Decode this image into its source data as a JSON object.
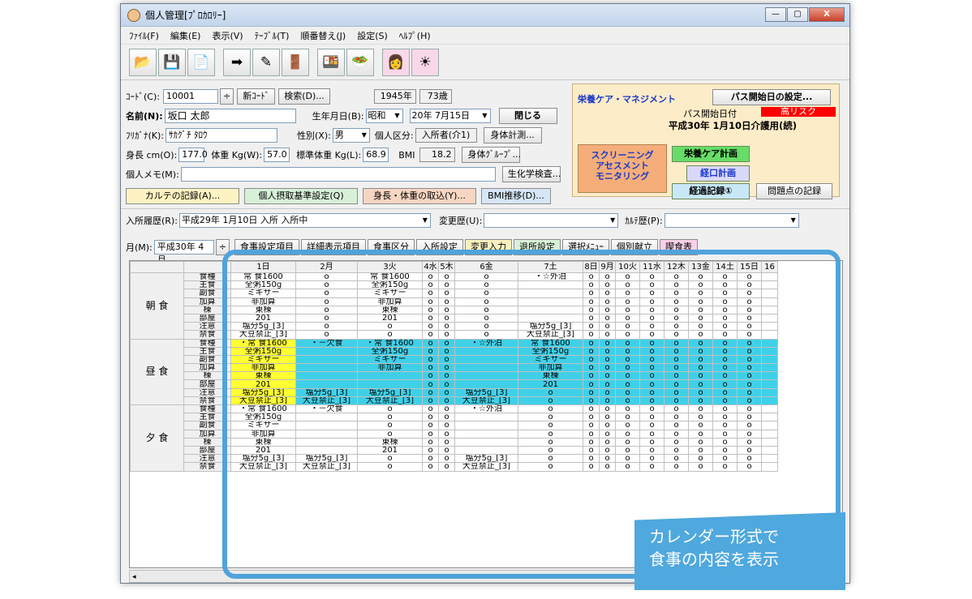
{
  "window": {
    "title": "個人管理[ﾌﾟﾛｶﾛﾘｰ]",
    "controls": [
      "—",
      "▢",
      "X"
    ]
  },
  "menu": [
    "ﾌｧｲﾙ(F)",
    "編集(E)",
    "表示(V)",
    "ﾃｰﾌﾞﾙ(T)",
    "順番替え(J)",
    "設定(S)",
    "ﾍﾙﾌﾟ(H)"
  ],
  "toolbar": [
    "folder-open",
    "save",
    "copy",
    "exit",
    "edit",
    "door",
    "person-meal",
    "salad",
    "chef",
    "sun"
  ],
  "form": {
    "code_label": "ｺｰﾄﾞ(C):",
    "code": "10001",
    "new_code": "新ｺｰﾄﾞ",
    "search": "検索(D)...",
    "birth_year": "1945年",
    "age": "73歳",
    "name_label": "名前(N):",
    "name": "坂口 太郎",
    "birth_label": "生年月日(B):",
    "era": "昭和",
    "birth_date": "20年 7月15日",
    "close": "閉じる",
    "kana_label": "ﾌﾘｶﾞﾅ(K):",
    "kana": "ｻｶｸﾞﾁ ﾀﾛｳ",
    "sex_label": "性別(X):",
    "sex": "男",
    "kubun_label": "個人区分:",
    "kubun": "入所者(介1)",
    "body_measure": "身体計測...",
    "height_label": "身長 cm(O):",
    "height": "177.0",
    "weight_label": "体重 Kg(W):",
    "weight": "57.0",
    "std_weight_label": "標準体重 Kg(L):",
    "std_weight": "68.9",
    "bmi_label": "BMI",
    "bmi": "18.2",
    "body_group": "身体ｸﾞﾙｰﾌﾟ...",
    "memo_label": "個人メモ(M):",
    "memo": "",
    "biochem": "生化学検査...",
    "karte": "カルテの記録(A)...",
    "standard": "個人摂取基準設定(Q)",
    "import": "身長・体重の取込(Y)...",
    "bmi_trend": "BMI推移(D)..."
  },
  "panel": {
    "title": "栄養ケア・マネジメント",
    "pass_btn": "パス開始日の設定...",
    "pass_start": "パス開始日付",
    "hi_risk": "高リスク",
    "date": "平成30年 1月10日介護用(続)",
    "screening": "スクリーニング\nアセスメント\nモニタリング",
    "care_plan": "栄養ケア計画",
    "oral_plan": "経口計画",
    "progress": "経過記録①",
    "problem": "問題点の記録"
  },
  "history": {
    "label": "入所履歴(R):",
    "value": "平成29年 1月10日 入所 入所中",
    "change_label": "変更歴(U):",
    "karte_label": "ｶﾙﾃ歴(P):"
  },
  "month": {
    "label": "月(M):",
    "value": "平成30年 4月",
    "buttons": [
      "食事設定項目",
      "詳細表示項目",
      "食事区分",
      "入所設定",
      "変更入力",
      "退所設定",
      "選択ﾒﾆｭｰ",
      "個別献立",
      "喫食表"
    ]
  },
  "grid": {
    "days": [
      "1日",
      "2月",
      "3火",
      "4水",
      "5木",
      "6金",
      "7土",
      "8日",
      "9月",
      "10火",
      "11水",
      "12木",
      "13金",
      "14土",
      "15日",
      "16"
    ],
    "items": [
      "食種",
      "主食",
      "副食",
      "加算",
      "棟",
      "部屋",
      "注意",
      "禁食"
    ],
    "meals": [
      {
        "name": "朝 食",
        "rows": [
          [
            "常 食1600",
            "o",
            "常 食1600",
            "o",
            "o",
            "o",
            "・☆外泊",
            "o",
            "o",
            "o",
            "o",
            "o",
            "o",
            "o",
            "o"
          ],
          [
            "全粥150g",
            "o",
            "全粥150g",
            "o",
            "o",
            "o",
            "",
            "o",
            "o",
            "o",
            "o",
            "o",
            "o",
            "o",
            "o"
          ],
          [
            "ミキサー",
            "o",
            "ミキサー",
            "o",
            "o",
            "o",
            "",
            "o",
            "o",
            "o",
            "o",
            "o",
            "o",
            "o",
            "o"
          ],
          [
            "非加算",
            "o",
            "非加算",
            "o",
            "o",
            "o",
            "",
            "o",
            "o",
            "o",
            "o",
            "o",
            "o",
            "o",
            "o"
          ],
          [
            "東棟",
            "o",
            "東棟",
            "o",
            "o",
            "o",
            "",
            "o",
            "o",
            "o",
            "o",
            "o",
            "o",
            "o",
            "o"
          ],
          [
            "201",
            "o",
            "201",
            "o",
            "o",
            "o",
            "",
            "o",
            "o",
            "o",
            "o",
            "o",
            "o",
            "o",
            "o"
          ],
          [
            "塩分5g_[3]",
            "o",
            "o",
            "o",
            "o",
            "o",
            "塩分5g_[3]",
            "o",
            "o",
            "o",
            "o",
            "o",
            "o",
            "o",
            "o"
          ],
          [
            "大豆禁止_[3]",
            "o",
            "o",
            "o",
            "o",
            "o",
            "大豆禁止_[3]",
            "o",
            "o",
            "o",
            "o",
            "o",
            "o",
            "o",
            "o"
          ]
        ]
      },
      {
        "name": "昼 食",
        "rows": [
          [
            "・常 食1600",
            "・－欠食",
            "・常 食1600",
            "o",
            "o",
            "・☆外泊",
            "常 食1600",
            "o",
            "o",
            "o",
            "o",
            "o",
            "o",
            "o",
            "o"
          ],
          [
            "全粥150g",
            "",
            "全粥150g",
            "o",
            "o",
            "",
            "全粥150g",
            "o",
            "o",
            "o",
            "o",
            "o",
            "o",
            "o",
            "o"
          ],
          [
            "ミキサー",
            "",
            "ミキサー",
            "o",
            "o",
            "",
            "ミキサー",
            "o",
            "o",
            "o",
            "o",
            "o",
            "o",
            "o",
            "o"
          ],
          [
            "非加算",
            "",
            "非加算",
            "o",
            "o",
            "",
            "非加算",
            "o",
            "o",
            "o",
            "o",
            "o",
            "o",
            "o",
            "o"
          ],
          [
            "東棟",
            "",
            "",
            "o",
            "o",
            "",
            "東棟",
            "o",
            "o",
            "o",
            "o",
            "o",
            "o",
            "o",
            "o"
          ],
          [
            "201",
            "",
            "",
            "o",
            "o",
            "",
            "201",
            "o",
            "o",
            "o",
            "o",
            "o",
            "o",
            "o",
            "o"
          ],
          [
            "塩分5g_[3]",
            "塩分5g_[3]",
            "塩分5g_[3]",
            "o",
            "o",
            "塩分5g_[3]",
            "o",
            "o",
            "o",
            "o",
            "o",
            "o",
            "o",
            "o",
            "o"
          ],
          [
            "大豆禁止_[3]",
            "大豆禁止_[3]",
            "大豆禁止_[3]",
            "o",
            "o",
            "大豆禁止_[3]",
            "o",
            "o",
            "o",
            "o",
            "o",
            "o",
            "o",
            "o",
            "o"
          ]
        ]
      },
      {
        "name": "夕 食",
        "rows": [
          [
            "・常 食1600",
            "・－欠食",
            "o",
            "o",
            "o",
            "・☆外泊",
            "o",
            "o",
            "o",
            "o",
            "o",
            "o",
            "o",
            "o",
            "o"
          ],
          [
            "全粥150g",
            "",
            "o",
            "o",
            "o",
            "",
            "o",
            "o",
            "o",
            "o",
            "o",
            "o",
            "o",
            "o",
            "o"
          ],
          [
            "ミキサー",
            "",
            "o",
            "o",
            "o",
            "",
            "o",
            "o",
            "o",
            "o",
            "o",
            "o",
            "o",
            "o",
            "o"
          ],
          [
            "非加算",
            "",
            "o",
            "o",
            "o",
            "",
            "o",
            "o",
            "o",
            "o",
            "o",
            "o",
            "o",
            "o",
            "o"
          ],
          [
            "東棟",
            "",
            "東棟",
            "o",
            "o",
            "",
            "o",
            "o",
            "o",
            "o",
            "o",
            "o",
            "o",
            "o",
            "o"
          ],
          [
            "201",
            "",
            "201",
            "o",
            "o",
            "",
            "o",
            "o",
            "o",
            "o",
            "o",
            "o",
            "o",
            "o",
            "o"
          ],
          [
            "塩分5g_[3]",
            "塩分5g_[3]",
            "o",
            "o",
            "o",
            "塩分5g_[3]",
            "o",
            "o",
            "o",
            "o",
            "o",
            "o",
            "o",
            "o",
            "o"
          ],
          [
            "大豆禁止_[3]",
            "大豆禁止_[3]",
            "o",
            "o",
            "o",
            "大豆禁止_[3]",
            "o",
            "o",
            "o",
            "o",
            "o",
            "o",
            "o",
            "o",
            "o"
          ]
        ]
      }
    ]
  },
  "note": [
    "カレンダー形式で",
    "食事の内容を表示"
  ],
  "colors": {
    "highlight": "#3fd0e8",
    "selected": "#ffff33",
    "callout": "#4fa3dc"
  }
}
